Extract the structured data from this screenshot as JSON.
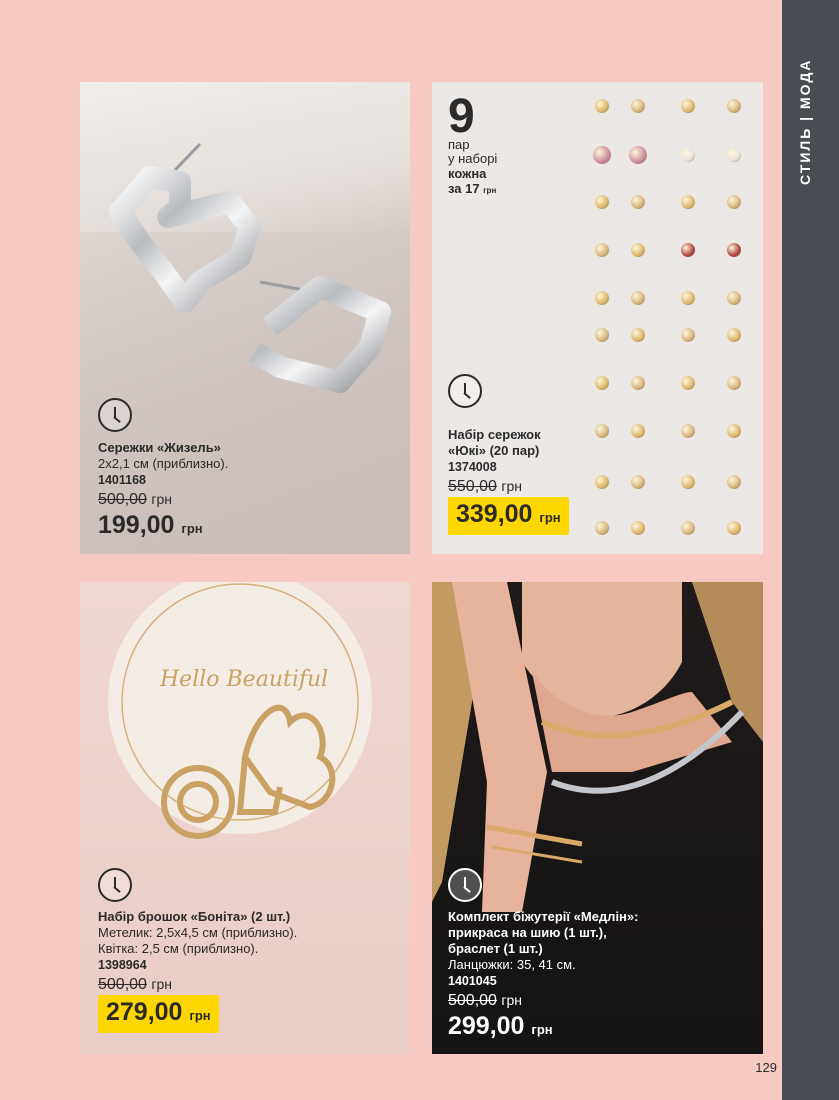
{
  "sidebar": {
    "label": "СТИЛЬ | МОДА"
  },
  "page_number": "129",
  "products": [
    {
      "name": "Сережки «Жизель»",
      "details": [
        "2х2,1 см (приблизно)."
      ],
      "sku": "1401168",
      "old_price": "500,00",
      "new_price": "199,00",
      "currency": "грн"
    },
    {
      "name_lines": [
        "Набір сережок",
        "«Юкі» (20 пар)"
      ],
      "sku": "1374008",
      "old_price": "550,00",
      "new_price": "339,00",
      "currency": "грн",
      "promo": {
        "number": "9",
        "line1": "пар",
        "line2": "у наборі",
        "line3": "кожна",
        "line4": "за 17",
        "unit": "грн"
      }
    },
    {
      "name": "Набір брошок «Боніта» (2 шт.)",
      "details": [
        "Метелик: 2,5х4,5 см (приблизно).",
        "Квітка: 2,5 см (приблизно)."
      ],
      "sku": "1398964",
      "old_price": "500,00",
      "new_price": "279,00",
      "currency": "грн",
      "image_text": "Hello Beautiful"
    },
    {
      "name_lines": [
        "Комплект біжутерії «Медлін»:",
        "прикраса на шию (1 шт.),",
        "браслет (1 шт.)"
      ],
      "details": [
        "Ланцюжки: 35, 41 см."
      ],
      "sku": "1401045",
      "old_price": "500,00",
      "new_price": "299,00",
      "currency": "грн"
    }
  ],
  "colors": {
    "background": "#f6c9c3",
    "sidebar": "#4a4c53",
    "badge": "#ffd700"
  }
}
